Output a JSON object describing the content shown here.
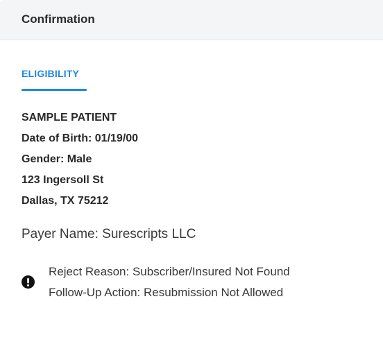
{
  "header": {
    "title": "Confirmation"
  },
  "tabs": [
    {
      "label": "ELIGIBILITY",
      "active": true
    }
  ],
  "accent_color": "#1e88e5",
  "patient": {
    "name": "SAMPLE PATIENT",
    "dob": "Date of Birth: 01/19/00",
    "gender": "Gender: Male",
    "address_line1": "123 Ingersoll St",
    "address_line2": "Dallas, TX 75212"
  },
  "payer": {
    "name_line": "Payer Name: Surescripts LLC"
  },
  "reject": {
    "icon": "alert-circle-icon",
    "reason": "Reject Reason: Subscriber/Insured Not Found",
    "followup": "Follow-Up Action: Resubmission Not Allowed"
  }
}
